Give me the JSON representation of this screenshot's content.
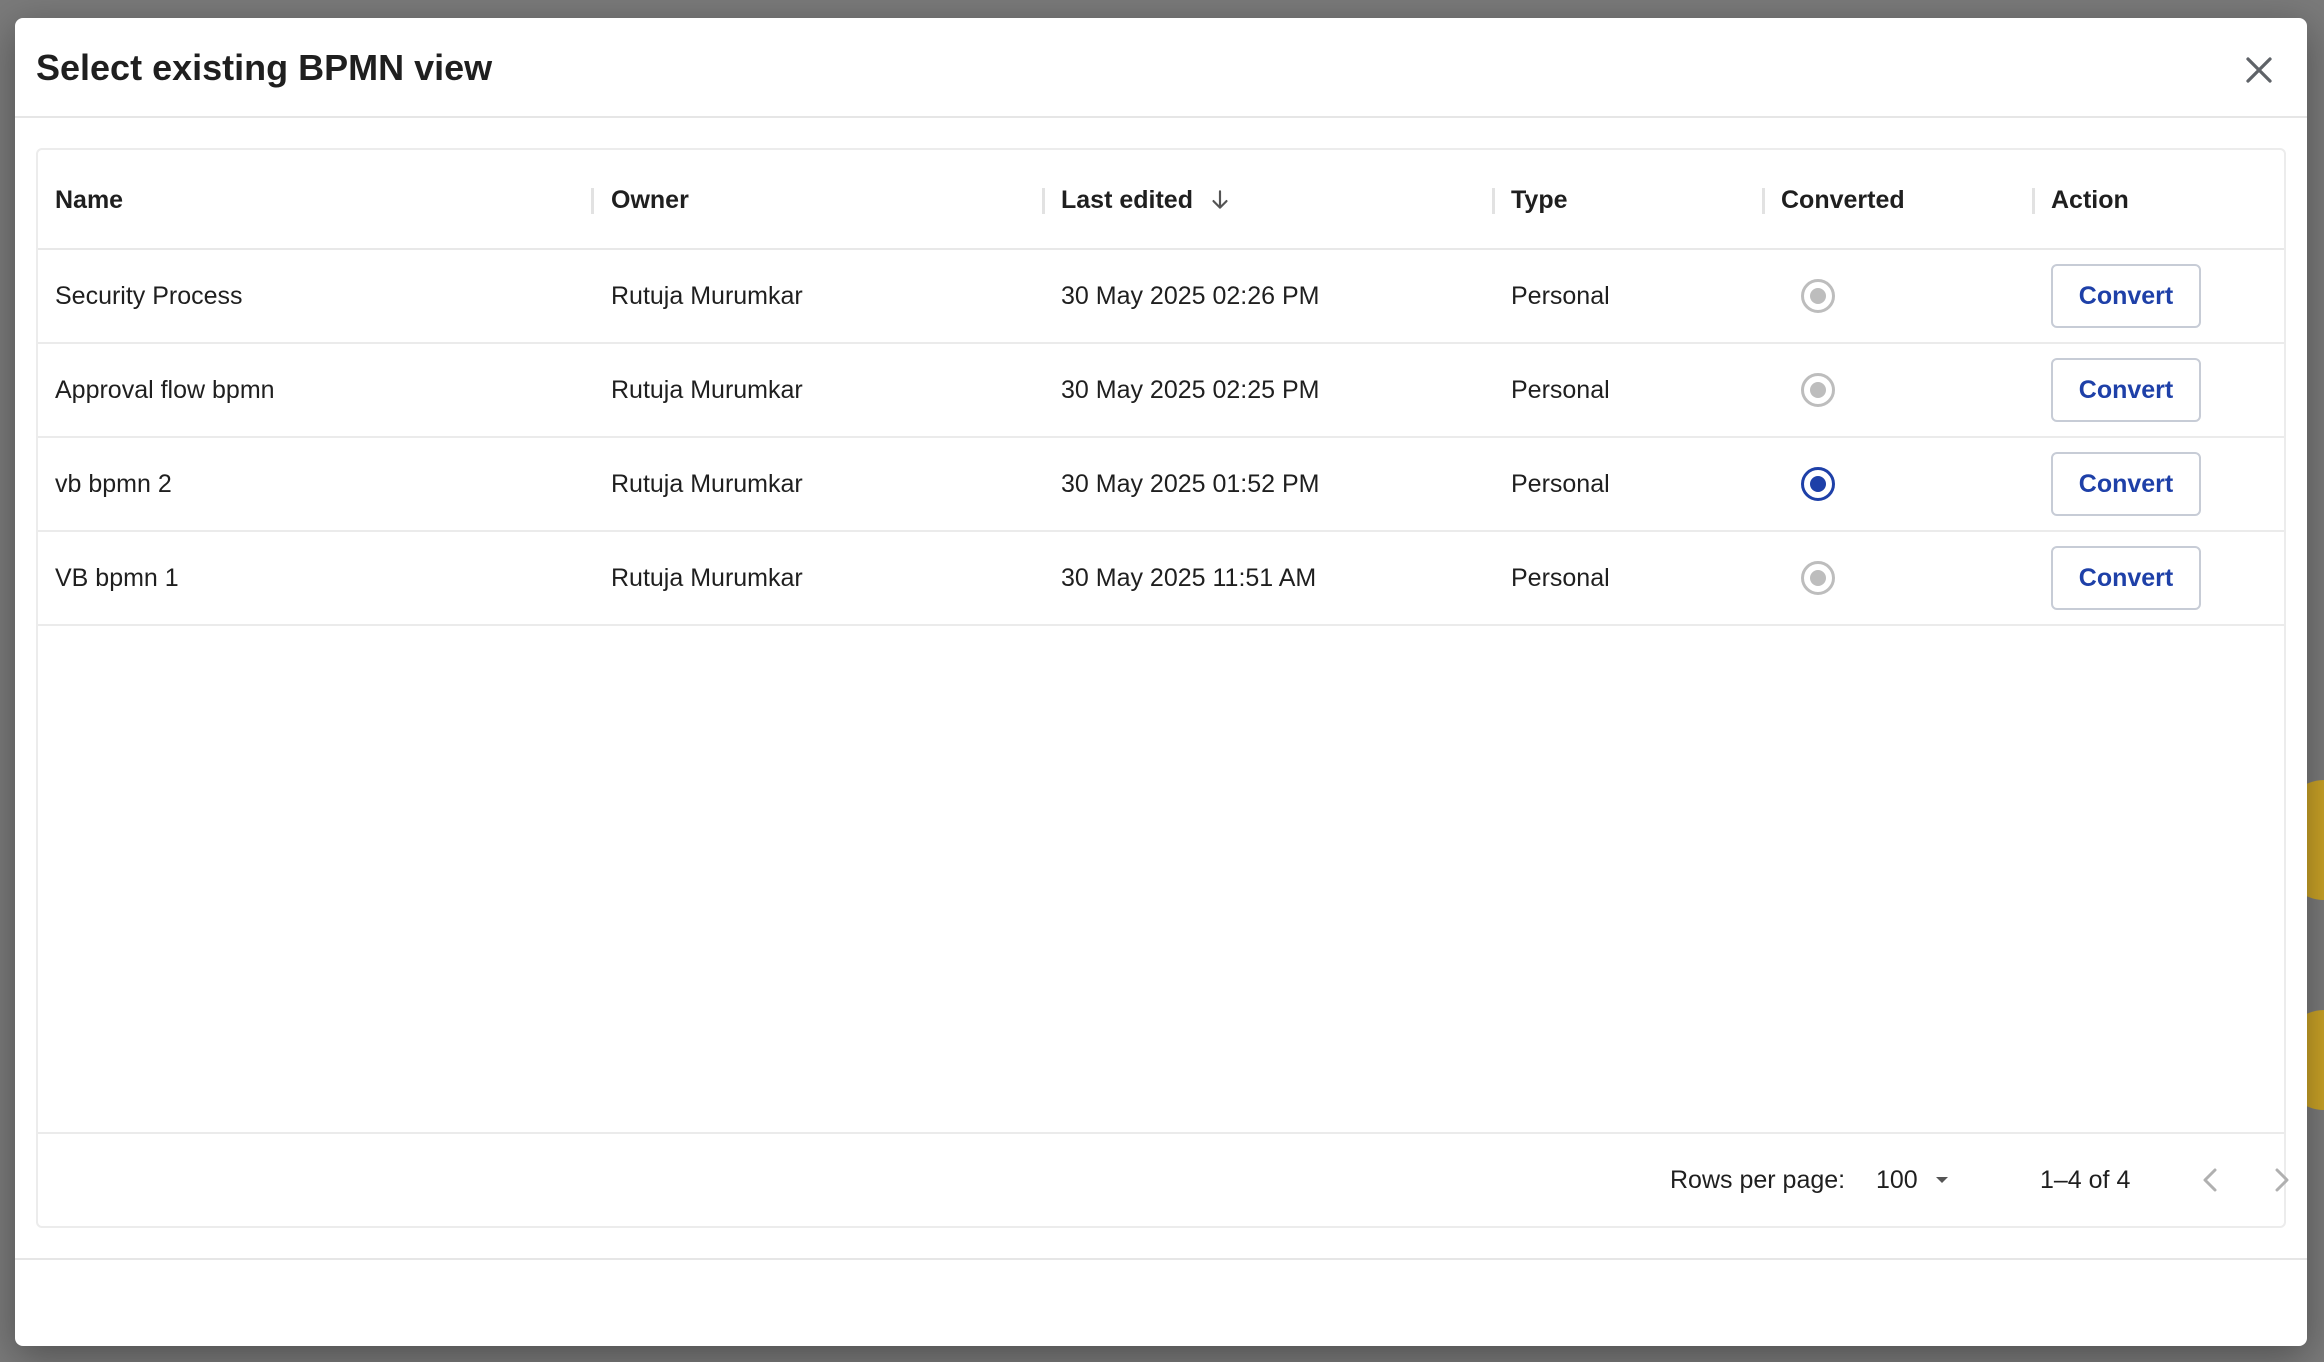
{
  "dialog": {
    "title": "Select existing BPMN view",
    "close_icon": "close-icon"
  },
  "table": {
    "columns": [
      {
        "label": "Name"
      },
      {
        "label": "Owner"
      },
      {
        "label": "Last edited",
        "sort_icon": "arrow-down-icon"
      },
      {
        "label": "Type"
      },
      {
        "label": "Converted"
      },
      {
        "label": "Action"
      }
    ],
    "rows": [
      {
        "name": "Security Process",
        "owner": "Rutuja Murumkar",
        "last_edited": "30 May 2025 02:26 PM",
        "type": "Personal",
        "converted": false,
        "action": "Convert"
      },
      {
        "name": "Approval flow bpmn",
        "owner": "Rutuja Murumkar",
        "last_edited": "30 May 2025 02:25 PM",
        "type": "Personal",
        "converted": false,
        "action": "Convert"
      },
      {
        "name": "vb bpmn 2",
        "owner": "Rutuja Murumkar",
        "last_edited": "30 May 2025 01:52 PM",
        "type": "Personal",
        "converted": true,
        "action": "Convert"
      },
      {
        "name": "VB bpmn 1",
        "owner": "Rutuja Murumkar",
        "last_edited": "30 May 2025 11:51 AM",
        "type": "Personal",
        "converted": false,
        "action": "Convert"
      }
    ]
  },
  "pagination": {
    "rows_per_page_label": "Rows per page:",
    "rows_per_page_value": "100",
    "range_text": "1–4 of 4",
    "prev_icon": "chevron-left-icon",
    "next_icon": "chevron-right-icon"
  },
  "colors": {
    "accent": "#1e40a8",
    "radio_inactive": "#bdbdbd"
  }
}
